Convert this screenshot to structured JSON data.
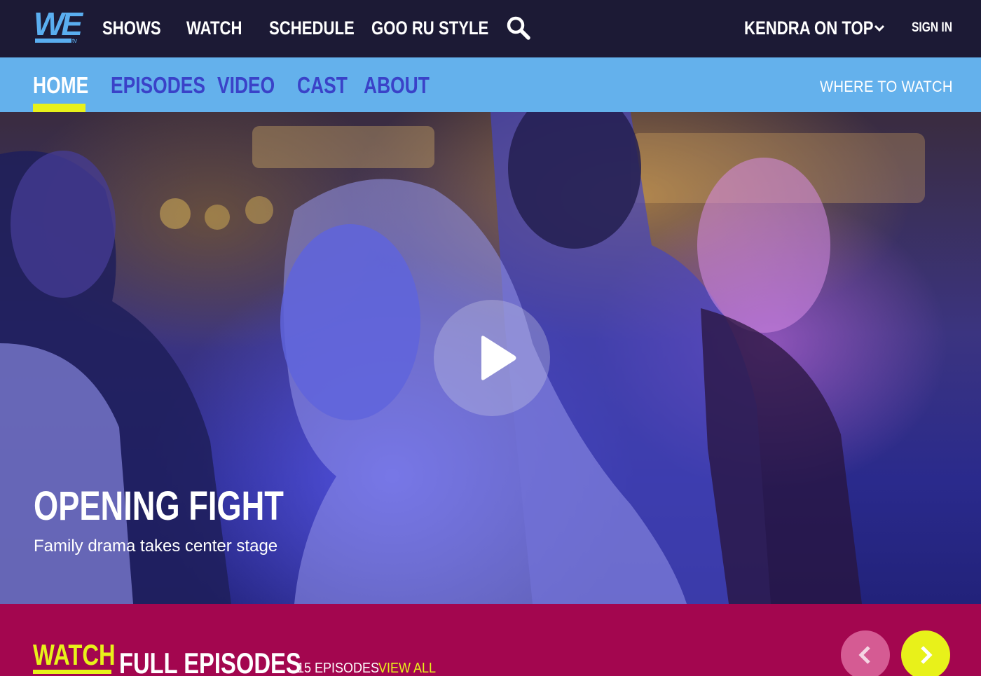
{
  "brand": {
    "logo_text": "WE",
    "logo_sub": "tv"
  },
  "main_nav": {
    "items": [
      "SHOWS",
      "WATCH",
      "SCHEDULE",
      "GOO RU STYLE"
    ],
    "search_icon": "search-icon"
  },
  "show_selector": {
    "label": "KENDRA ON TOP",
    "icon": "chevron-down-icon"
  },
  "account": {
    "sign_in": "SIGN IN"
  },
  "sub_nav": {
    "tabs": [
      "HOME",
      "EPISODES",
      "VIDEO",
      "CAST",
      "ABOUT"
    ],
    "active_tab": "HOME",
    "where_to_watch": "WHERE TO WATCH"
  },
  "hero": {
    "title": "OPENING FIGHT",
    "subtitle": "Family drama takes center stage",
    "play_icon": "play-icon"
  },
  "episodes_section": {
    "heading_highlight": "WATCH",
    "heading_rest": "FULL EPISODES",
    "count": "15 EPISODES",
    "view_all": "VIEW ALL",
    "prev_icon": "chevron-left-icon",
    "next_icon": "chevron-right-icon"
  },
  "colors": {
    "top_bar": "#1c1a35",
    "sub_nav": "#64b1ec",
    "sub_nav_text": "#3a42c8",
    "accent_yellow": "#e8f11a",
    "episodes_bg": "#a3064f"
  }
}
